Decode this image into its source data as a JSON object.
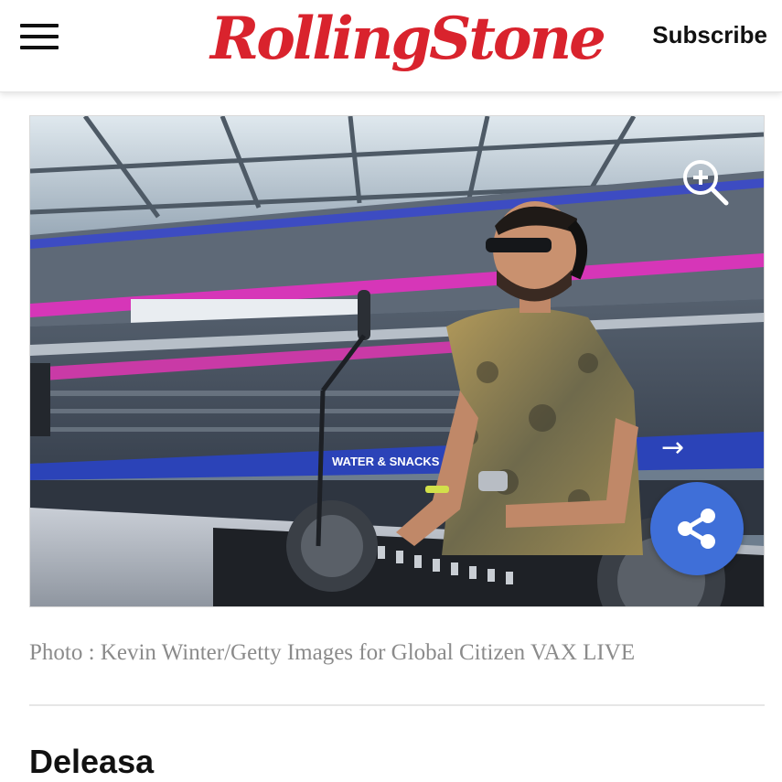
{
  "header": {
    "menu_icon": "hamburger-menu-icon",
    "logo_text": "RollingStone",
    "subscribe_label": "Subscribe",
    "brand_color": "#d9232d"
  },
  "photo": {
    "zoom_icon": "zoom-in-icon",
    "share_icon": "share-icon",
    "share_color": "#3f6fd8",
    "banner_text": "WATER & SNACKS"
  },
  "caption": "Photo : Kevin Winter/Getty Images for Global Citizen VAX LIVE",
  "article": {
    "artist_name": "Deleasa"
  }
}
